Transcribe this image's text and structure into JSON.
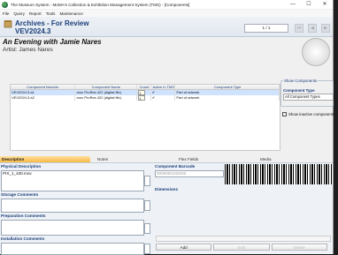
{
  "window": {
    "title": "The Museum System - MoMA's Collection & Exhibition Management System (TMS) - [Components]",
    "controls": [
      "—",
      "☐",
      "✕"
    ]
  },
  "menu": [
    "File",
    "Query",
    "Report",
    "Tools",
    "Maintenance"
  ],
  "header": {
    "line1": "Archives - For Review",
    "line2": "VEV2024.3",
    "pager": "1 / 1"
  },
  "object": {
    "title": "An Evening with Jamie Nares",
    "artist": "Artist: James Nares"
  },
  "components": {
    "columns": [
      "Component Number",
      "Component Name",
      "Count",
      "Active in TMS",
      "Component Type"
    ],
    "rows": [
      {
        "number": "VEV2024.3.a1",
        "name": ".mov ProRes 422 (digital file)",
        "count": "1",
        "active": "✔",
        "type": "Part of artwork"
      },
      {
        "number": "VEV2024.3.a2",
        "name": ".mov ProRes 422 (digital file)",
        "count": "1",
        "active": "✔",
        "type": "Part of artwork"
      }
    ]
  },
  "side_panel": {
    "group_label": "Show Components",
    "type_label": "Component Type",
    "type_value": "All Component Types",
    "inactive_label": "Show inactive components"
  },
  "tabs": [
    "Description",
    "Notes",
    "Flex Fields",
    "Media"
  ],
  "description": {
    "physical_label": "Physical Description",
    "physical_value": "PIX_1_430.mov",
    "storage_label": "Storage Comments",
    "prep_label": "Preparation Comments",
    "install_label": "Installation Comments",
    "barcode_label": "Component Barcode",
    "barcode_value": "0000000102003",
    "dimensions_label": "Dimensions"
  },
  "bottom_buttons": [
    "Add",
    "Edit",
    "Delete"
  ]
}
